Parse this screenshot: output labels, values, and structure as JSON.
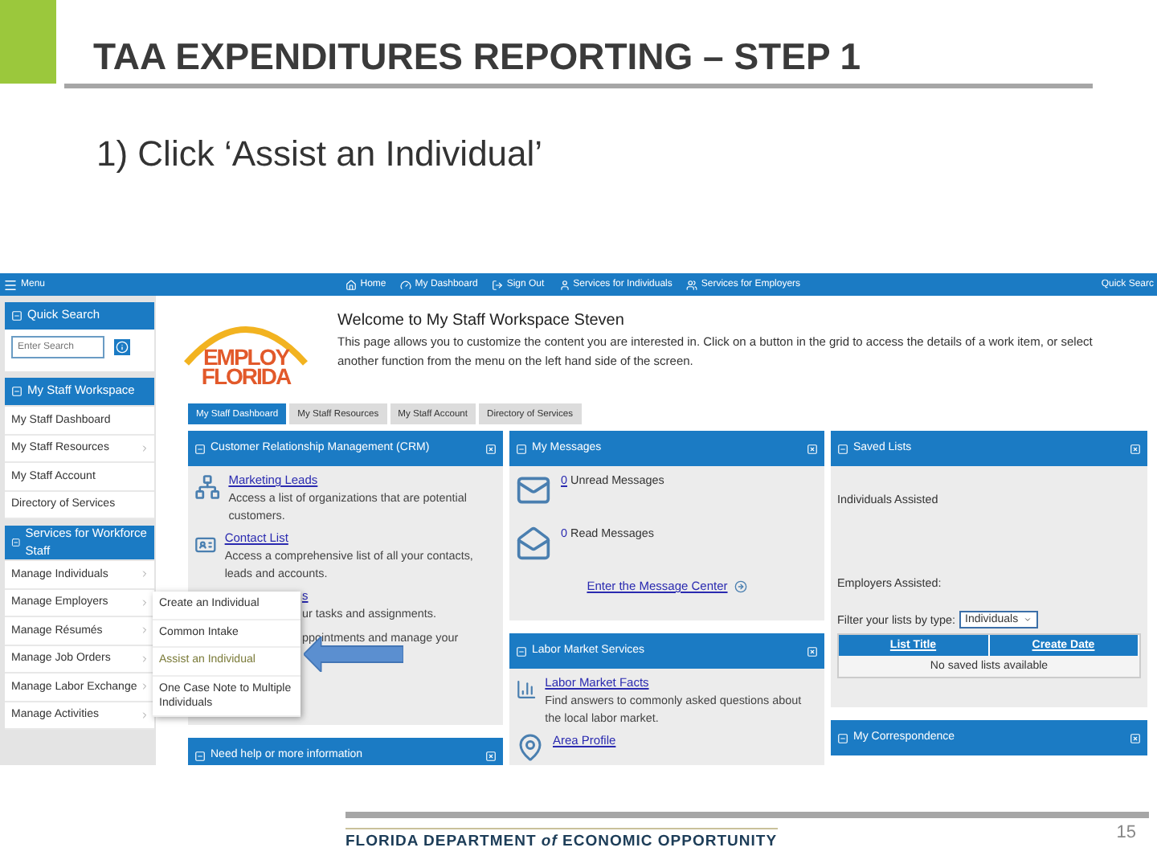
{
  "slide": {
    "title": "TAA EXPENDITURES REPORTING – STEP 1",
    "instruction": "1) Click ‘Assist an Individual’",
    "footer_logo": "FLORIDA DEPARTMENT *of* ECONOMIC OPPORTUNITY",
    "page_number": "15"
  },
  "top_bar": {
    "menu": "Menu",
    "links": [
      {
        "label": "Home",
        "kind": "home"
      },
      {
        "label": "My Dashboard",
        "kind": "dashboard"
      },
      {
        "label": "Sign Out",
        "kind": "signout"
      },
      {
        "label": "Services for Individuals",
        "kind": "person"
      },
      {
        "label": "Services for Employers",
        "kind": "group"
      }
    ],
    "quick_search": "Quick Searc"
  },
  "sidebar": {
    "quick_search": {
      "title": "Quick Search",
      "placeholder": "Enter Search"
    },
    "sections": [
      {
        "title": "My Staff Workspace",
        "items": [
          {
            "label": "My Staff Dashboard",
            "submenu": false
          },
          {
            "label": "My Staff Resources",
            "submenu": true
          },
          {
            "label": "My Staff Account",
            "submenu": false
          },
          {
            "label": "Directory of Services",
            "submenu": false
          }
        ]
      },
      {
        "title": "Services for Workforce Staff",
        "items": [
          {
            "label": "Manage Individuals",
            "submenu": true
          },
          {
            "label": "Manage Employers",
            "submenu": true
          },
          {
            "label": "Manage Résumés",
            "submenu": true
          },
          {
            "label": "Manage Job Orders",
            "submenu": true
          },
          {
            "label": "Manage Labor Exchange",
            "submenu": true
          },
          {
            "label": "Manage Activities",
            "submenu": true
          }
        ]
      }
    ]
  },
  "flyout": [
    {
      "label": "Create an Individual",
      "selected": false
    },
    {
      "label": "Common Intake",
      "selected": false
    },
    {
      "label": "Assist an Individual",
      "selected": true
    },
    {
      "label": "One Case Note to Multiple Individuals",
      "selected": false
    }
  ],
  "logo": {
    "line1": "EMPLOY",
    "line2": "FLORIDA"
  },
  "welcome": {
    "title": "Welcome to My Staff Workspace Steven",
    "text": "This page allows you to customize the content you are interested in. Click on a button in the grid to access the details of a work item, or select another function from the menu on the left hand side of the screen."
  },
  "tabs": [
    {
      "label": "My Staff Dashboard",
      "selected": true
    },
    {
      "label": "My Staff Resources",
      "selected": false
    },
    {
      "label": "My Staff Account",
      "selected": false
    },
    {
      "label": "Directory of Services",
      "selected": false
    }
  ],
  "crm": {
    "title": "Customer Relationship Management (CRM)",
    "items": [
      {
        "kind": "org",
        "link": "Marketing Leads",
        "description": "Access a list of organizations that are potential customers."
      },
      {
        "kind": "contact",
        "link": "Contact List",
        "description": "Access a comprehensive list of all your contacts, leads and accounts."
      },
      {
        "kind": "hidden",
        "link": "s",
        "description": "ur tasks and assignments."
      },
      {
        "kind": "hidden",
        "description": "ppointments and manage your"
      }
    ]
  },
  "help": {
    "title": "Need help or more information"
  },
  "messages": {
    "title": "My Messages",
    "items": [
      {
        "kind": "unread",
        "count": "0",
        "label": "Unread Messages",
        "linked": true
      },
      {
        "kind": "read",
        "count": "0",
        "label": "Read Messages",
        "linked": false
      }
    ],
    "center_link": "Enter the Message Center"
  },
  "labor": {
    "title": "Labor Market Services",
    "items": [
      {
        "kind": "chart",
        "link": "Labor Market Facts",
        "description": "Find answers to commonly asked questions about the local labor market."
      },
      {
        "kind": "pin",
        "link": "Area Profile"
      }
    ]
  },
  "saved": {
    "title": "Saved Lists",
    "individuals": "Individuals Assisted",
    "employers": "Employers Assisted:",
    "filter_label": "Filter your lists by type:",
    "filter_value": "Individuals",
    "columns": [
      "List Title",
      "Create Date"
    ],
    "empty": "No saved lists available"
  },
  "correspondence": {
    "title": "My Correspondence"
  }
}
